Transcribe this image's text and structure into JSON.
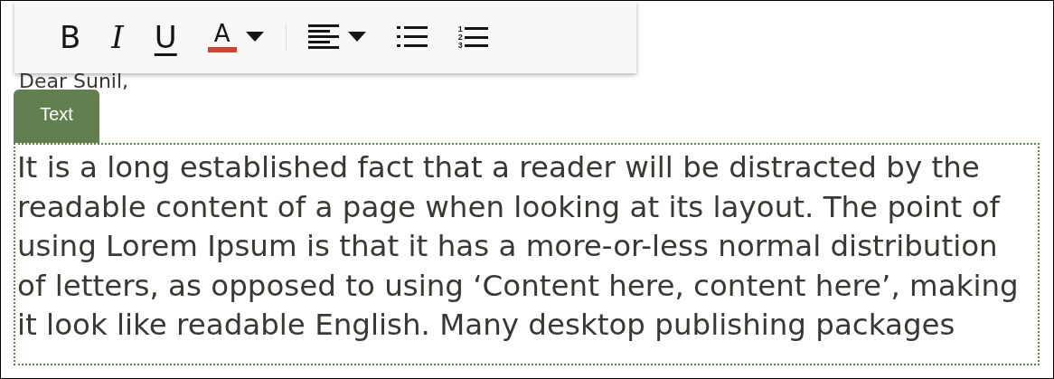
{
  "toolbar": {
    "groups": [
      [
        {
          "kind": "bold",
          "label": "B"
        },
        {
          "kind": "italic",
          "label": "I"
        },
        {
          "kind": "underline",
          "label": "U"
        },
        {
          "kind": "font-color",
          "label": "A",
          "menu": true
        }
      ],
      [
        {
          "kind": "align-left",
          "menu": true
        },
        {
          "kind": "bullet-list"
        },
        {
          "kind": "numbered-list",
          "numbers": [
            "1",
            "2",
            "3"
          ]
        }
      ]
    ]
  },
  "greeting": "Dear Sunil,",
  "block": {
    "tag": "Text",
    "lines": [
      "It is a long established fact that a reader will be distracted by the",
      "readable content of a page when looking at its layout. The point of",
      "using Lorem Ipsum is that it has a more-or-less normal distribution",
      "of letters, as opposed to using ‘Content here, content here’, making",
      "it look like readable English. Many desktop publishing packages"
    ]
  }
}
